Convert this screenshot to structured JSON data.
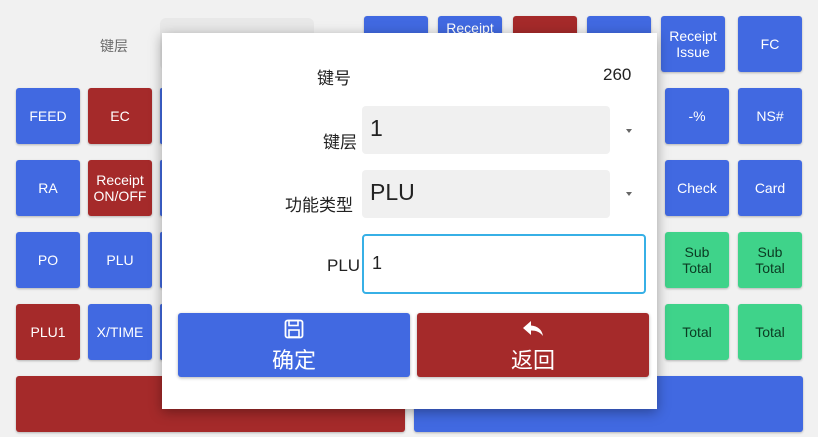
{
  "background": {
    "key_layer_label": "键层",
    "keys": [
      {
        "id": "top-1",
        "label": "",
        "color": "blue"
      },
      {
        "id": "top-2",
        "label": "Receipt",
        "color": "blue"
      },
      {
        "id": "top-3",
        "label": "",
        "color": "red"
      },
      {
        "id": "top-4",
        "label": "",
        "color": "blue"
      },
      {
        "id": "receipt-issue",
        "label": "Receipt\nIssue",
        "color": "blue"
      },
      {
        "id": "fc",
        "label": "FC",
        "color": "blue"
      },
      {
        "id": "feed",
        "label": "FEED",
        "color": "blue"
      },
      {
        "id": "ec",
        "label": "EC",
        "color": "red"
      },
      {
        "id": "percent-minus",
        "label": "-%",
        "color": "blue"
      },
      {
        "id": "ns",
        "label": "NS#",
        "color": "blue"
      },
      {
        "id": "ra",
        "label": "RA",
        "color": "blue"
      },
      {
        "id": "receipt-onoff",
        "label": "Receipt\nON/OFF",
        "color": "red"
      },
      {
        "id": "check",
        "label": "Check",
        "color": "blue"
      },
      {
        "id": "card",
        "label": "Card",
        "color": "blue"
      },
      {
        "id": "po",
        "label": "PO",
        "color": "blue"
      },
      {
        "id": "plu",
        "label": "PLU",
        "color": "blue"
      },
      {
        "id": "subtotal-1",
        "label": "Sub\nTotal",
        "color": "green"
      },
      {
        "id": "subtotal-2",
        "label": "Sub\nTotal",
        "color": "green"
      },
      {
        "id": "plu1",
        "label": "PLU1",
        "color": "red"
      },
      {
        "id": "xtime",
        "label": "X/TIME",
        "color": "blue"
      },
      {
        "id": "total-1",
        "label": "Total",
        "color": "green"
      },
      {
        "id": "total-2",
        "label": "Total",
        "color": "green"
      }
    ],
    "bottom_left_color": "#a52a2a",
    "bottom_right_color": "#4169e1"
  },
  "dialog": {
    "key_number_label": "键号",
    "key_number_value": "260",
    "layer_label": "键层",
    "layer_value": "1",
    "function_type_label": "功能类型",
    "function_type_value": "PLU",
    "plu_label": "PLU",
    "plu_value": "1",
    "confirm_label": "确定",
    "back_label": "返回",
    "confirm_color": "#4169e1",
    "back_color": "#a52a2a",
    "confirm_icon": "save-icon",
    "back_icon": "undo-arrow-icon"
  }
}
